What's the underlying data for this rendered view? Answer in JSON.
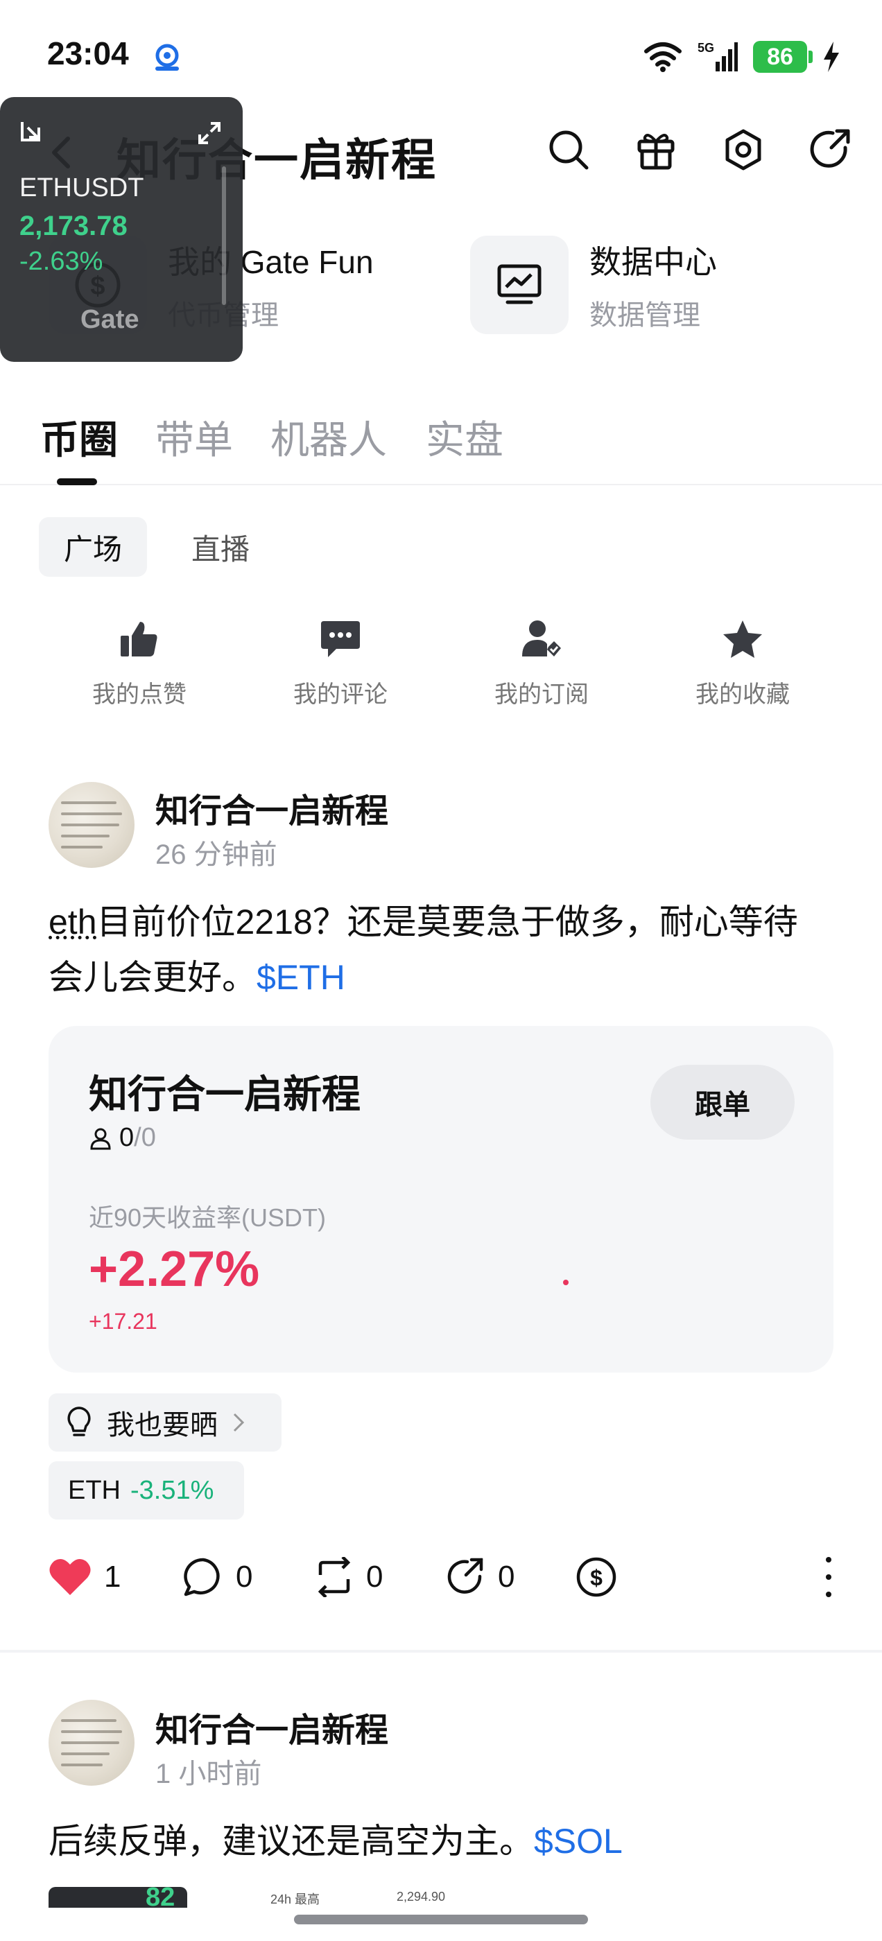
{
  "status_bar": {
    "time": "23:04",
    "network": "5G",
    "battery": "86"
  },
  "header": {
    "title": "知行合一启新程"
  },
  "shortcuts": [
    {
      "title": "我的 Gate Fun",
      "subtitle": "代币管理"
    },
    {
      "title": "数据中心",
      "subtitle": "数据管理"
    }
  ],
  "float_widget": {
    "pair": "ETHUSDT",
    "price": "2,173.78",
    "change": "-2.63%",
    "logo": "Gate"
  },
  "main_tabs": [
    "币圈",
    "带单",
    "机器人",
    "实盘"
  ],
  "sub_tabs": [
    "广场",
    "直播"
  ],
  "quick_actions": [
    "我的点赞",
    "我的评论",
    "我的订阅",
    "我的收藏"
  ],
  "post1": {
    "author": "知行合一启新程",
    "time": "26 分钟前",
    "text_prefix": "eth",
    "text_body": "目前价位2218？还是莫要急于做多，耐心等待会儿会更好。",
    "tag": "$ETH",
    "card": {
      "name": "知行合一启新程",
      "followers_current": "0",
      "followers_max": "/0",
      "follow_label": "跟单",
      "yield_label": "近90天收益率(USDT)",
      "yield": "+2.27%",
      "abs_gain": "+17.21"
    },
    "show_label": "我也要晒",
    "coin": {
      "symbol": "ETH",
      "change": "-3.51%"
    },
    "likes": "1",
    "comments": "0",
    "reposts": "0",
    "shares": "0"
  },
  "post2": {
    "author": "知行合一启新程",
    "time": "1 小时前",
    "text": "后续反弹，建议还是高空为主。",
    "tag": "$SOL",
    "peek_price": "82",
    "peek_label1": "24h 最高",
    "peek_value1": "2,294.90"
  },
  "colors": {
    "up": "#e8355d",
    "down": "#19b27a",
    "link": "#1f6ee6",
    "battery": "#2dbd4a"
  }
}
